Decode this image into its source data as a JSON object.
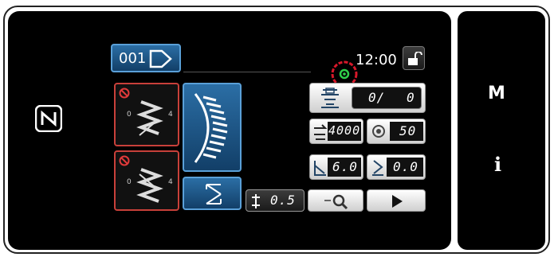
{
  "header": {
    "program_no": "001",
    "time": "12:00"
  },
  "counters": {
    "bobbin_count": "0/",
    "bobbin_value": "0",
    "speed": "4000",
    "tension": "50",
    "feed": "6.0",
    "pitch": "0.0",
    "zigzag": "0.5"
  },
  "side_buttons": {
    "mode": "M",
    "info": "i"
  },
  "colors": {
    "accent_blue": "#2b6ea5",
    "warning_red": "#c8403a",
    "status_green": "#2fcf4a",
    "highlight_circle": "#d8182a"
  },
  "icons": [
    "nfc-icon",
    "lock-icon",
    "bobbin-icon",
    "speed-icon",
    "tension-icon",
    "feed-icon",
    "pitch-icon",
    "zigzag-icon",
    "search-icon",
    "play-icon"
  ]
}
